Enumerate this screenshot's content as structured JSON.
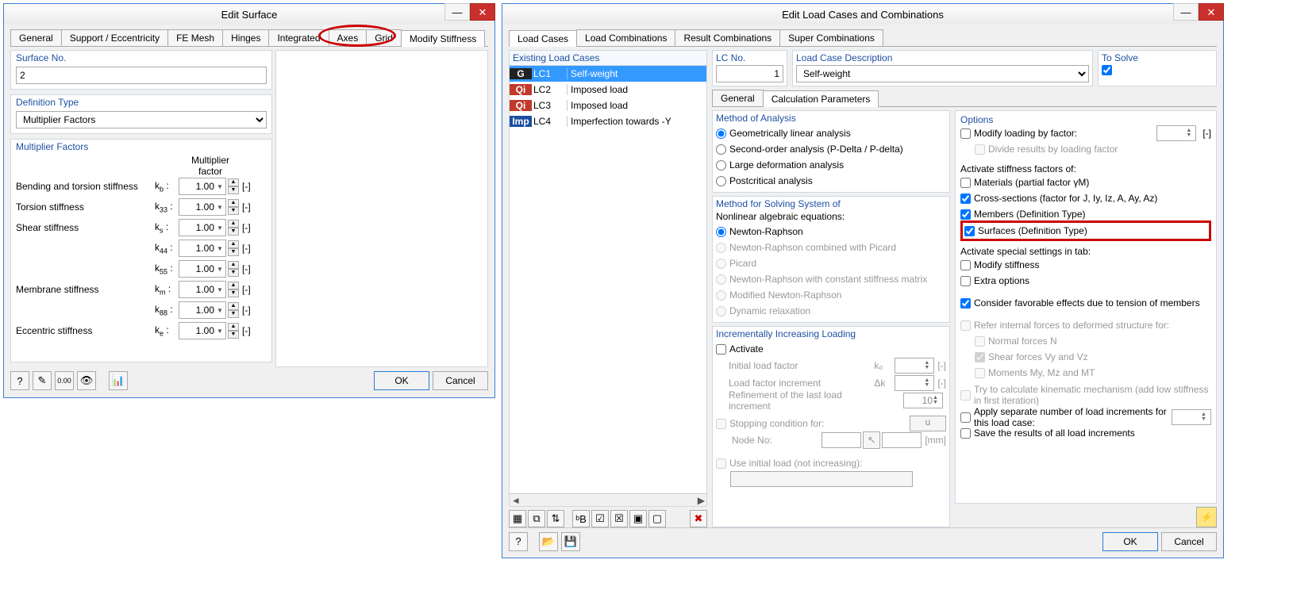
{
  "win1": {
    "title": "Edit Surface",
    "tabs": [
      "General",
      "Support / Eccentricity",
      "FE Mesh",
      "Hinges",
      "Integrated",
      "Axes",
      "Grid",
      "Modify Stiffness"
    ],
    "surface_no_label": "Surface No.",
    "surface_no_value": "2",
    "def_type_label": "Definition Type",
    "def_type_value": "Multiplier Factors",
    "mf_title": "Multiplier Factors",
    "mf_header": "Multiplier factor",
    "rows": [
      {
        "label": "Bending and torsion stiffness",
        "k": "kb",
        "val": "1.00"
      },
      {
        "label": "Torsion stiffness",
        "k": "k33",
        "val": "1.00"
      },
      {
        "label": "Shear stiffness",
        "k": "ks",
        "val": "1.00"
      },
      {
        "label": "",
        "k": "k44",
        "val": "1.00"
      },
      {
        "label": "",
        "k": "k55",
        "val": "1.00"
      },
      {
        "label": "Membrane stiffness",
        "k": "km",
        "val": "1.00"
      },
      {
        "label": "",
        "k": "k88",
        "val": "1.00"
      },
      {
        "label": "Eccentric stiffness",
        "k": "ke",
        "val": "1.00"
      }
    ],
    "unit": "[-]",
    "ok": "OK",
    "cancel": "Cancel"
  },
  "win2": {
    "title": "Edit Load Cases and Combinations",
    "tabs": [
      "Load Cases",
      "Load Combinations",
      "Result Combinations",
      "Super Combinations"
    ],
    "existing_title": "Existing Load Cases",
    "lcs": [
      {
        "badge": "G",
        "cls": "g",
        "name": "LC1",
        "desc": "Self-weight",
        "sel": true
      },
      {
        "badge": "Qi",
        "cls": "qi",
        "name": "LC2",
        "desc": "Imposed load"
      },
      {
        "badge": "Qi",
        "cls": "qi",
        "name": "LC3",
        "desc": "Imposed load"
      },
      {
        "badge": "Imp",
        "cls": "imp",
        "name": "LC4",
        "desc": "Imperfection towards -Y"
      }
    ],
    "lcno_label": "LC No.",
    "lcno_val": "1",
    "lcdesc_label": "Load Case Description",
    "lcdesc_val": "Self-weight",
    "tosolve_label": "To Solve",
    "subtabs": [
      "General",
      "Calculation Parameters"
    ],
    "method_title": "Method of Analysis",
    "methods": [
      "Geometrically linear analysis",
      "Second-order analysis (P-Delta / P-delta)",
      "Large deformation analysis",
      "Postcritical analysis"
    ],
    "solve_title": "Method for Solving System of",
    "solve_sub": "Nonlinear algebraic equations:",
    "solvers": [
      "Newton-Raphson",
      "Newton-Raphson combined with Picard",
      "Picard",
      "Newton-Raphson with constant stiffness matrix",
      "Modified Newton-Raphson",
      "Dynamic relaxation"
    ],
    "inc_title": "Incrementally Increasing Loading",
    "inc_activate": "Activate",
    "inc_rows": [
      {
        "label": "Initial load factor",
        "k": "k₀",
        "val": "",
        "u": "[-]"
      },
      {
        "label": "Load factor increment",
        "k": "Δk",
        "val": "",
        "u": "[-]"
      },
      {
        "label": "Refinement of the last load increment",
        "k": "",
        "val": "10",
        "u": ""
      }
    ],
    "stop_label": "Stopping condition for:",
    "stop_val": "u",
    "node_label": "Node No:",
    "node_unit": "[mm]",
    "use_initial": "Use initial load (not increasing):",
    "opt_title": "Options",
    "opt_modify": "Modify loading by factor:",
    "opt_divide": "Divide results by loading factor",
    "opt_unit": "[-]",
    "act_title": "Activate stiffness factors of:",
    "act_items": [
      {
        "label": "Materials (partial factor γM)",
        "chk": false
      },
      {
        "label": "Cross-sections (factor for J, Iy, Iz, A, Ay, Az)",
        "chk": true
      },
      {
        "label": "Members (Definition Type)",
        "chk": true
      },
      {
        "label": "Surfaces (Definition Type)",
        "chk": true,
        "hl": true
      }
    ],
    "spec_title": "Activate special settings in tab:",
    "spec_items": [
      "Modify stiffness",
      "Extra options"
    ],
    "consider": "Consider favorable effects due to tension of members",
    "refer": "Refer internal forces to deformed structure for:",
    "refer_items": [
      {
        "label": "Normal forces N",
        "chk": false
      },
      {
        "label": "Shear forces Vy and Vz",
        "chk": true
      },
      {
        "label": "Moments My, Mz and MT",
        "chk": false
      }
    ],
    "kin": "Try to calculate kinematic mechanism (add low stiffness in first iteration)",
    "apply_sep": "Apply separate number of load increments for this load case:",
    "save_res": "Save the results of all load increments",
    "ok": "OK",
    "cancel": "Cancel"
  }
}
